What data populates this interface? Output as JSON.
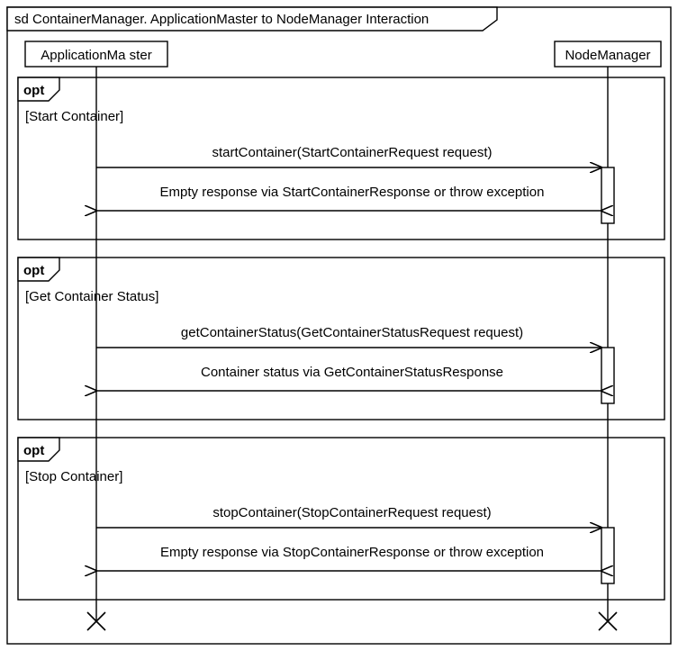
{
  "diagram": {
    "title": "sd ContainerManager. ApplicationMaster to NodeManager Interaction",
    "participants": {
      "left": "ApplicationMa ster",
      "right": "NodeManager"
    },
    "fragments": [
      {
        "type": "opt",
        "guard": "[Start Container]",
        "messages": [
          {
            "text": "startContainer(StartContainerRequest request)",
            "direction": "right"
          },
          {
            "text": "Empty response via StartContainerResponse or throw exception",
            "direction": "left"
          }
        ]
      },
      {
        "type": "opt",
        "guard": "[Get Container Status]",
        "messages": [
          {
            "text": "getContainerStatus(GetContainerStatusRequest request)",
            "direction": "right"
          },
          {
            "text": "Container status via GetContainerStatusResponse",
            "direction": "left"
          }
        ]
      },
      {
        "type": "opt",
        "guard": "[Stop Container]",
        "messages": [
          {
            "text": "stopContainer(StopContainerRequest request)",
            "direction": "right"
          },
          {
            "text": "Empty response via StopContainerResponse or throw exception",
            "direction": "left"
          }
        ]
      }
    ]
  },
  "chart_data": {
    "type": "uml-sequence-diagram",
    "title": "sd ContainerManager. ApplicationMaster to NodeManager Interaction",
    "participants": [
      "ApplicationMaster",
      "NodeManager"
    ],
    "fragments": [
      {
        "operator": "opt",
        "guard": "Start Container",
        "messages": [
          {
            "from": "ApplicationMaster",
            "to": "NodeManager",
            "label": "startContainer(StartContainerRequest request)"
          },
          {
            "from": "NodeManager",
            "to": "ApplicationMaster",
            "label": "Empty response via StartContainerResponse or throw exception"
          }
        ]
      },
      {
        "operator": "opt",
        "guard": "Get Container Status",
        "messages": [
          {
            "from": "ApplicationMaster",
            "to": "NodeManager",
            "label": "getContainerStatus(GetContainerStatusRequest request)"
          },
          {
            "from": "NodeManager",
            "to": "ApplicationMaster",
            "label": "Container status via GetContainerStatusResponse"
          }
        ]
      },
      {
        "operator": "opt",
        "guard": "Stop Container",
        "messages": [
          {
            "from": "ApplicationMaster",
            "to": "NodeManager",
            "label": "stopContainer(StopContainerRequest request)"
          },
          {
            "from": "NodeManager",
            "to": "ApplicationMaster",
            "label": "Empty response via StopContainerResponse or throw exception"
          }
        ]
      }
    ]
  }
}
